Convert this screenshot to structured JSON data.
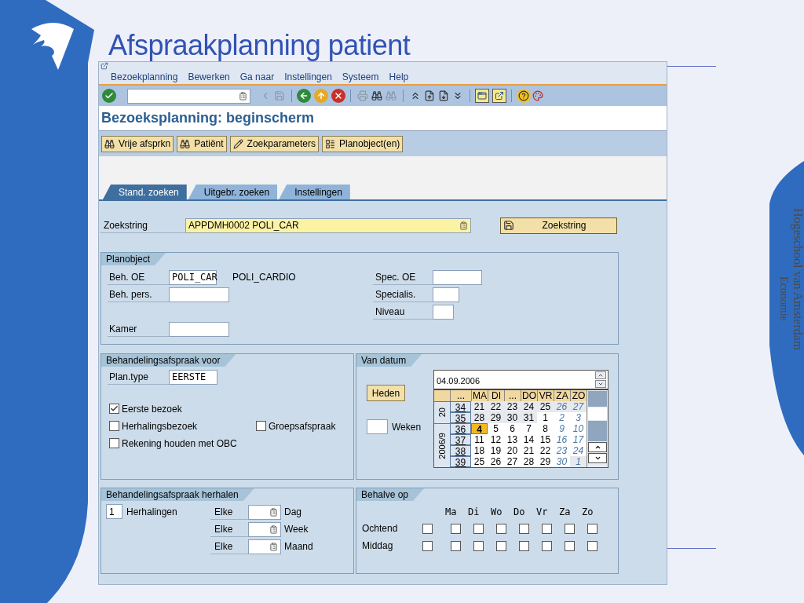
{
  "slide": {
    "title": "Afspraakplanning patient",
    "side_title": "Hogeschool van Amsterdam",
    "side_subtitle": "Economie"
  },
  "menu": [
    "Bezoekplanning",
    "Bewerken",
    "Ga naar",
    "Instellingen",
    "Systeem",
    "Help"
  ],
  "screen_title": "Bezoeksplanning: beginscherm",
  "app_buttons": [
    "Vrije afsprkn",
    "Patiënt",
    "Zoekparameters",
    "Planobject(en)"
  ],
  "tabs": [
    {
      "label": "Stand. zoeken",
      "selected": true
    },
    {
      "label": "Uitgebr. zoeken",
      "selected": false
    },
    {
      "label": "Instellingen",
      "selected": false
    }
  ],
  "search": {
    "label": "Zoekstring",
    "value": "APPDMH0002 POLI_CAR",
    "button": "Zoekstring"
  },
  "planobject": {
    "title": "Planobject",
    "rows": [
      {
        "left": {
          "label": "Beh. OE",
          "value": "POLI_CAR",
          "description": "POLI_CARDIO"
        },
        "right": {
          "label": "Spec. OE"
        }
      },
      {
        "left": {
          "label": "Beh. pers."
        },
        "right": {
          "label": "Specialis."
        }
      },
      {
        "right": {
          "label": "Niveau"
        }
      },
      {
        "left": {
          "label": "Kamer"
        }
      }
    ]
  },
  "treatment": {
    "title": "Behandelingsafspraak voor",
    "plan_type": {
      "label": "Plan.type",
      "value": "EERSTE"
    },
    "checkbox_rows": [
      [
        {
          "label": "Eerste bezoek",
          "checked": true
        }
      ],
      [
        {
          "label": "Herhalingsbezoek",
          "checked": false
        },
        {
          "label": "Groepsafspraak",
          "checked": false
        }
      ],
      [
        {
          "label": "Rekening houden met OBC",
          "checked": false
        }
      ]
    ]
  },
  "from_date": {
    "title": "Van datum",
    "today_button": "Heden",
    "weeks_label": "Weken",
    "date": "04.09.2006",
    "calendar": {
      "headers": [
        "...",
        "MA",
        "DI",
        "...",
        "DO",
        "VR",
        "ZA",
        "ZO"
      ],
      "weeks": [
        {
          "month": "20",
          "week": "34",
          "days": [
            {
              "d": "21",
              "outside": true,
              "selected": false
            },
            {
              "d": "22",
              "outside": true,
              "selected": false
            },
            {
              "d": "23",
              "outside": true,
              "selected": false
            },
            {
              "d": "24",
              "outside": true,
              "selected": false
            },
            {
              "d": "25",
              "outside": true,
              "selected": false
            },
            {
              "d": "26",
              "outside": true,
              "selected": false
            },
            {
              "d": "27",
              "outside": true,
              "selected": false
            }
          ]
        },
        {
          "week": "35",
          "days": [
            {
              "d": "28",
              "outside": true,
              "selected": false
            },
            {
              "d": "29",
              "outside": true,
              "selected": false
            },
            {
              "d": "30",
              "outside": true,
              "selected": false
            },
            {
              "d": "31",
              "outside": true,
              "selected": false
            },
            {
              "d": "1",
              "outside": false,
              "selected": false
            },
            {
              "d": "2",
              "outside": false,
              "selected": false
            },
            {
              "d": "3",
              "outside": false,
              "selected": false
            }
          ]
        },
        {
          "month": "2006/9",
          "week": "36",
          "days": [
            {
              "d": "4",
              "outside": false,
              "selected": true
            },
            {
              "d": "5",
              "outside": false,
              "selected": false
            },
            {
              "d": "6",
              "outside": false,
              "selected": false
            },
            {
              "d": "7",
              "outside": false,
              "selected": false
            },
            {
              "d": "8",
              "outside": false,
              "selected": false
            },
            {
              "d": "9",
              "outside": false,
              "selected": false
            },
            {
              "d": "10",
              "outside": false,
              "selected": false
            }
          ]
        },
        {
          "week": "37",
          "days": [
            {
              "d": "11",
              "outside": false,
              "selected": false
            },
            {
              "d": "12",
              "outside": false,
              "selected": false
            },
            {
              "d": "13",
              "outside": false,
              "selected": false
            },
            {
              "d": "14",
              "outside": false,
              "selected": false
            },
            {
              "d": "15",
              "outside": false,
              "selected": false
            },
            {
              "d": "16",
              "outside": false,
              "selected": false
            },
            {
              "d": "17",
              "outside": false,
              "selected": false
            }
          ]
        },
        {
          "week": "38",
          "days": [
            {
              "d": "18",
              "outside": false,
              "selected": false
            },
            {
              "d": "19",
              "outside": false,
              "selected": false
            },
            {
              "d": "20",
              "outside": false,
              "selected": false
            },
            {
              "d": "21",
              "outside": false,
              "selected": false
            },
            {
              "d": "22",
              "outside": false,
              "selected": false
            },
            {
              "d": "23",
              "outside": false,
              "selected": false
            },
            {
              "d": "24",
              "outside": false,
              "selected": false
            }
          ]
        },
        {
          "week": "39",
          "days": [
            {
              "d": "25",
              "outside": false,
              "selected": false
            },
            {
              "d": "26",
              "outside": false,
              "selected": false
            },
            {
              "d": "27",
              "outside": false,
              "selected": false
            },
            {
              "d": "28",
              "outside": false,
              "selected": false
            },
            {
              "d": "29",
              "outside": false,
              "selected": false
            },
            {
              "d": "30",
              "outside": false,
              "selected": false
            },
            {
              "d": "1",
              "outside": true,
              "selected": false
            }
          ]
        }
      ]
    }
  },
  "repeat": {
    "title": "Behandelingsafspraak herhalen",
    "count": "1",
    "count_label": "Herhalingen",
    "rows": [
      {
        "prefix": "Elke",
        "unit": "Dag"
      },
      {
        "prefix": "Elke",
        "unit": "Week"
      },
      {
        "prefix": "Elke",
        "unit": "Maand"
      }
    ]
  },
  "except": {
    "title": "Behalve op",
    "days": [
      "Ma",
      "Di",
      "Wo",
      "Do",
      "Vr",
      "Za",
      "Zo"
    ],
    "rows": [
      {
        "label": "Ochtend",
        "checks": [
          {
            "checked": false
          },
          {
            "checked": false
          },
          {
            "checked": false
          },
          {
            "checked": false
          },
          {
            "checked": false
          },
          {
            "checked": false
          },
          {
            "checked": false
          },
          {
            "checked": false
          }
        ]
      },
      {
        "label": "Middag",
        "checks": [
          {
            "checked": false
          },
          {
            "checked": false
          },
          {
            "checked": false
          },
          {
            "checked": false
          },
          {
            "checked": false
          },
          {
            "checked": false
          },
          {
            "checked": false
          },
          {
            "checked": false
          }
        ]
      }
    ]
  }
}
